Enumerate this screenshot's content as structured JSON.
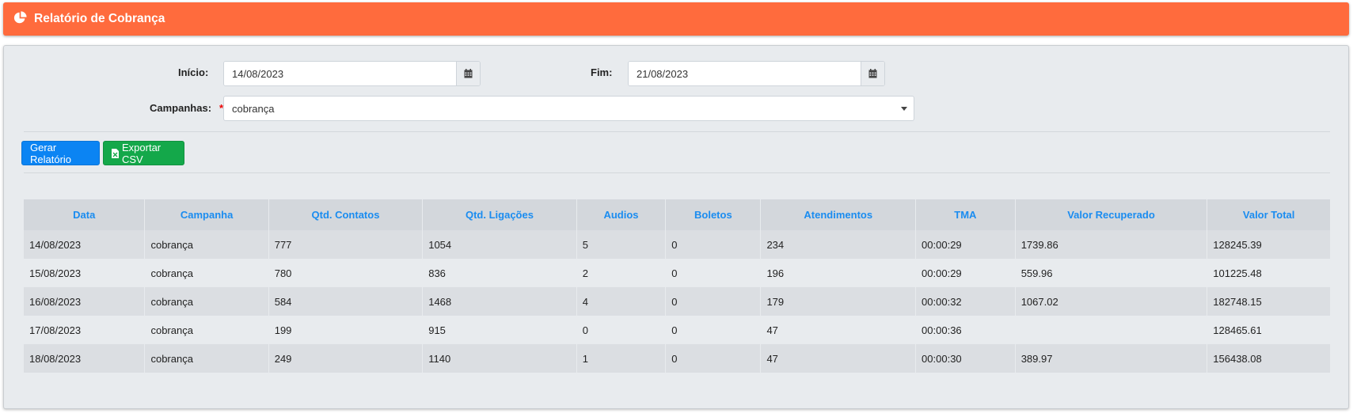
{
  "header": {
    "title": "Relatório de Cobrança",
    "icon": "pie-chart-icon",
    "color": "#ff6b3d"
  },
  "filters": {
    "inicio_label": "Início:",
    "inicio_value": "14/08/2023",
    "fim_label": "Fim:",
    "fim_value": "21/08/2023",
    "campanhas_label": "Campanhas:",
    "required_mark": "*",
    "campanhas_value": "cobrança"
  },
  "actions": {
    "gerar_label": "Gerar Relatório",
    "exportar_label": "Exportar CSV"
  },
  "table": {
    "columns": [
      "Data",
      "Campanha",
      "Qtd. Contatos",
      "Qtd. Ligações",
      "Audios",
      "Boletos",
      "Atendimentos",
      "TMA",
      "Valor Recuperado",
      "Valor Total"
    ],
    "rows": [
      [
        "14/08/2023",
        "cobrança",
        "777",
        "1054",
        "5",
        "0",
        "234",
        "00:00:29",
        "1739.86",
        "128245.39"
      ],
      [
        "15/08/2023",
        "cobrança",
        "780",
        "836",
        "2",
        "0",
        "196",
        "00:00:29",
        "559.96",
        "101225.48"
      ],
      [
        "16/08/2023",
        "cobrança",
        "584",
        "1468",
        "4",
        "0",
        "179",
        "00:00:32",
        "1067.02",
        "182748.15"
      ],
      [
        "17/08/2023",
        "cobrança",
        "199",
        "915",
        "0",
        "0",
        "47",
        "00:00:36",
        "",
        "128465.61"
      ],
      [
        "18/08/2023",
        "cobrança",
        "249",
        "1140",
        "1",
        "0",
        "47",
        "00:00:30",
        "389.97",
        "156438.08"
      ]
    ]
  }
}
